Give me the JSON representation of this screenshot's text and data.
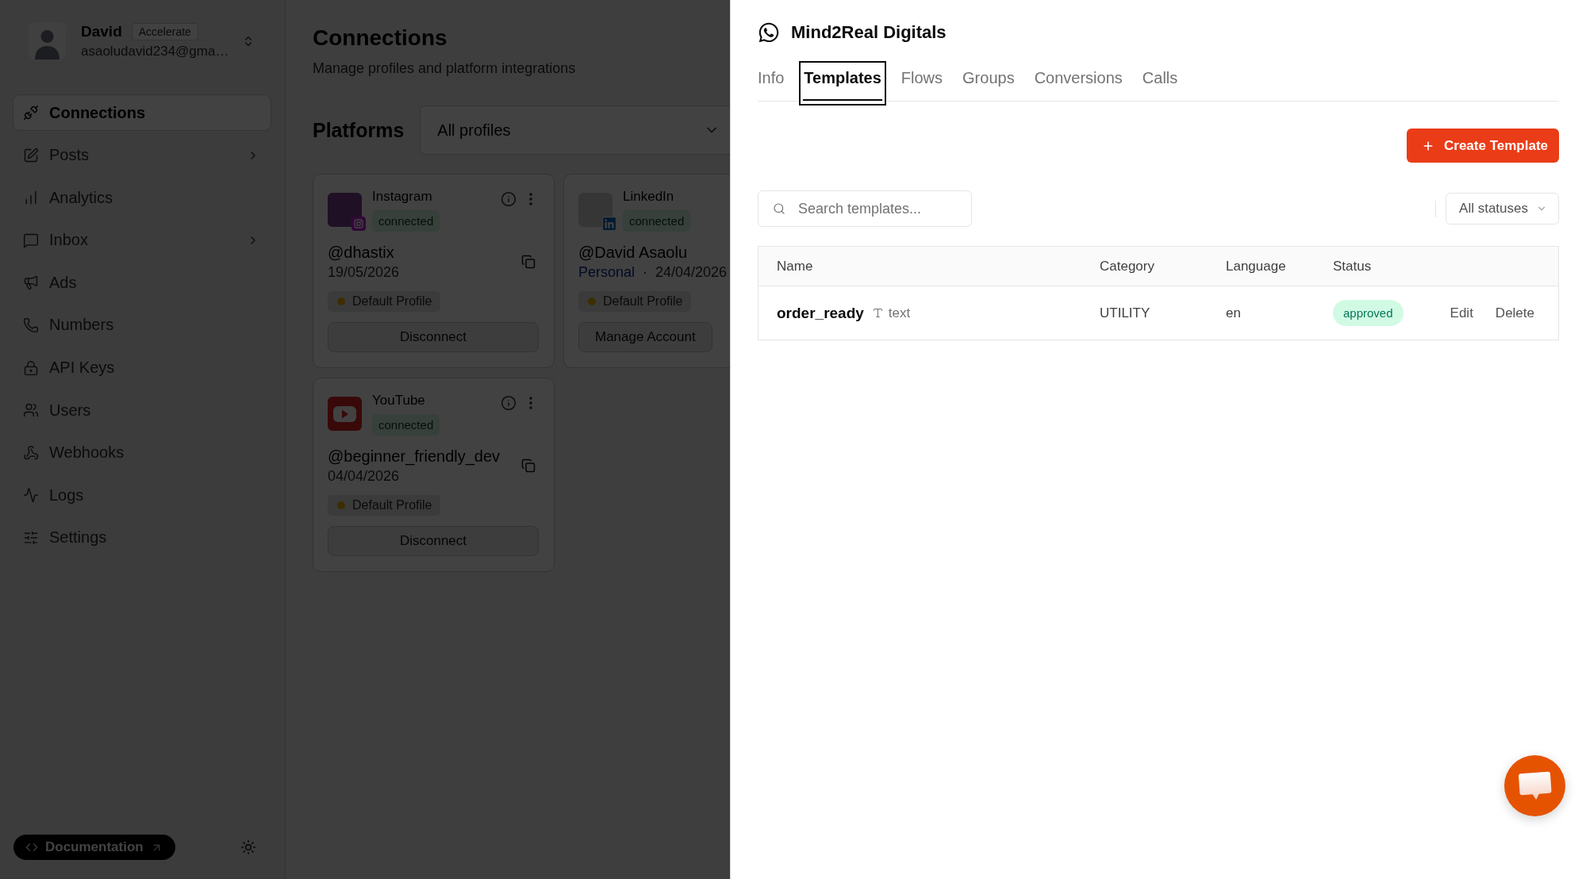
{
  "sidebar": {
    "user": {
      "name": "David",
      "plan": "Accelerate",
      "email": "asaoludavid234@gma…"
    },
    "nav": [
      {
        "label": "Connections",
        "selected": true,
        "submenu": false
      },
      {
        "label": "Posts",
        "selected": false,
        "submenu": true
      },
      {
        "label": "Analytics",
        "selected": false,
        "submenu": false
      },
      {
        "label": "Inbox",
        "selected": false,
        "submenu": true
      },
      {
        "label": "Ads",
        "selected": false,
        "submenu": false
      },
      {
        "label": "Numbers",
        "selected": false,
        "submenu": false
      },
      {
        "label": "API Keys",
        "selected": false,
        "submenu": false
      },
      {
        "label": "Users",
        "selected": false,
        "submenu": false
      },
      {
        "label": "Webhooks",
        "selected": false,
        "submenu": false
      },
      {
        "label": "Logs",
        "selected": false,
        "submenu": false
      },
      {
        "label": "Settings",
        "selected": false,
        "submenu": false
      }
    ],
    "footer": {
      "documentation_link": "Documentation"
    }
  },
  "page": {
    "title": "Connections",
    "subtitle": "Manage profiles and platform integrations",
    "section_title": "Platforms",
    "profile_filter": {
      "value": "All profiles"
    },
    "cards": [
      {
        "kind": "instagram",
        "platform": "Instagram",
        "status": "connected",
        "info": true,
        "menu": true,
        "handle": "@dhastix",
        "date": "19/05/2026",
        "copy": true,
        "profile": "Default Profile",
        "buttons": [
          "Disconnect"
        ]
      },
      {
        "kind": "linkedin",
        "platform": "LinkedIn",
        "status": "connected",
        "info": false,
        "menu": false,
        "handle": "@David Asaolu",
        "account_type": "Personal",
        "separator": "·",
        "date": "24/04/2026",
        "copy": false,
        "profile": "Default Profile",
        "buttons": [
          "Manage Account"
        ]
      },
      {
        "kind": "youtube",
        "platform": "YouTube",
        "status": "connected",
        "info": true,
        "menu": true,
        "handle": "@beginner_friendly_dev",
        "date": "04/04/2026",
        "copy": true,
        "profile": "Default Profile",
        "buttons": [
          "Disconnect"
        ]
      }
    ]
  },
  "sheet": {
    "title": "Mind2Real Digitals",
    "tabs": [
      {
        "label": "Info",
        "selected": false,
        "focused": false
      },
      {
        "label": "Templates",
        "selected": true,
        "focused": true
      },
      {
        "label": "Flows",
        "selected": false,
        "focused": false
      },
      {
        "label": "Groups",
        "selected": false,
        "focused": false
      },
      {
        "label": "Conversions",
        "selected": false,
        "focused": false
      },
      {
        "label": "Calls",
        "selected": false,
        "focused": false
      }
    ],
    "create_button": "Create Template",
    "search": {
      "placeholder": "Search templates..."
    },
    "status_filter": {
      "value": "All statuses"
    },
    "table": {
      "columns": [
        "Name",
        "Category",
        "Language",
        "Status"
      ],
      "rows": [
        {
          "name": "order_ready",
          "format": "text",
          "category": "UTILITY",
          "language": "en",
          "status": "approved",
          "actions": [
            "Edit",
            "Delete"
          ]
        }
      ]
    }
  }
}
